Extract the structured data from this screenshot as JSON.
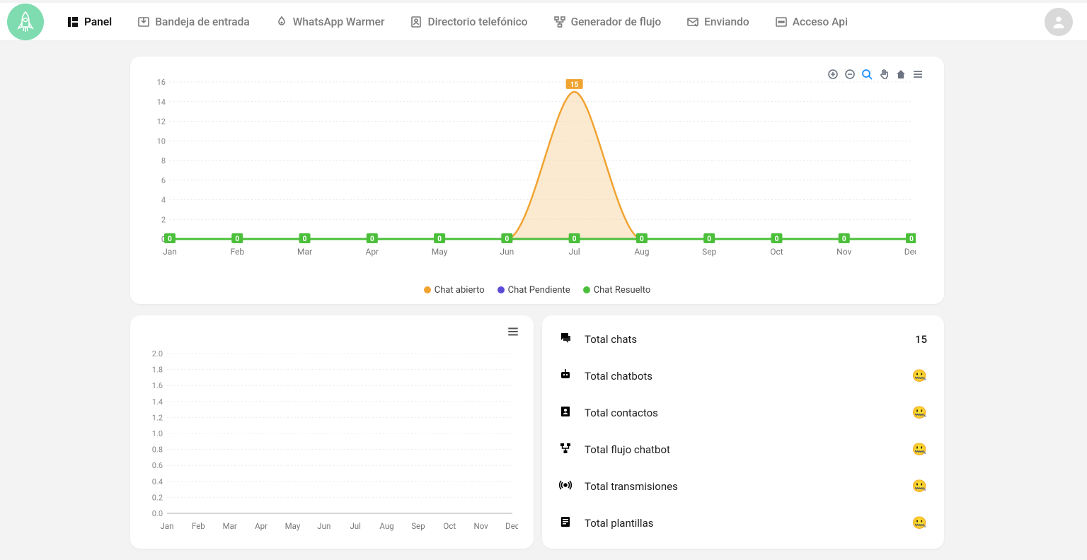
{
  "nav": [
    {
      "id": "panel",
      "label": "Panel",
      "active": true
    },
    {
      "id": "inbox",
      "label": "Bandeja de entrada",
      "active": false
    },
    {
      "id": "warmer",
      "label": "WhatsApp Warmer",
      "active": false
    },
    {
      "id": "phonebook",
      "label": "Directorio telefónico",
      "active": false
    },
    {
      "id": "flow",
      "label": "Generador de flujo",
      "active": false
    },
    {
      "id": "sending",
      "label": "Enviando",
      "active": false
    },
    {
      "id": "api",
      "label": "Acceso Api",
      "active": false
    }
  ],
  "stats": [
    {
      "icon": "chat",
      "label": "Total chats",
      "value": "15"
    },
    {
      "icon": "bot",
      "label": "Total chatbots",
      "value": "🤐"
    },
    {
      "icon": "contacts",
      "label": "Total contactos",
      "value": "🤐"
    },
    {
      "icon": "flow",
      "label": "Total flujo chatbot",
      "value": "🤐"
    },
    {
      "icon": "broadcast",
      "label": "Total transmisiones",
      "value": "🤐"
    },
    {
      "icon": "templates",
      "label": "Total plantillas",
      "value": "🤐"
    }
  ],
  "chart_data": [
    {
      "type": "area",
      "categories": [
        "Jan",
        "Feb",
        "Mar",
        "Apr",
        "May",
        "Jun",
        "Jul",
        "Aug",
        "Sep",
        "Oct",
        "Nov",
        "Dec"
      ],
      "series": [
        {
          "name": "Chat abierto",
          "color": "#f0a330",
          "values": [
            0,
            0,
            0,
            0,
            0,
            0,
            15,
            0,
            0,
            0,
            0,
            0
          ],
          "peak_label": "15",
          "peak_index": 6
        },
        {
          "name": "Chat Pendiente",
          "color": "#5b4bd6",
          "values": [
            0,
            0,
            0,
            0,
            0,
            0,
            0,
            0,
            0,
            0,
            0,
            0
          ]
        },
        {
          "name": "Chat Resuelto",
          "color": "#4bbf3a",
          "values": [
            0,
            0,
            0,
            0,
            0,
            0,
            0,
            0,
            0,
            0,
            0,
            0
          ],
          "labels_on_points": true
        }
      ],
      "ylim": [
        0,
        16
      ],
      "yticks": [
        0,
        2,
        4,
        6,
        8,
        10,
        12,
        14,
        16
      ]
    },
    {
      "type": "line",
      "categories": [
        "Jan",
        "Feb",
        "Mar",
        "Apr",
        "May",
        "Jun",
        "Jul",
        "Aug",
        "Sep",
        "Oct",
        "Nov",
        "Dec"
      ],
      "series": [
        {
          "name": "",
          "color": "#cccccc",
          "values": [
            0,
            0,
            0,
            0,
            0,
            0,
            0,
            0,
            0,
            0,
            0,
            0
          ]
        }
      ],
      "ylim": [
        0,
        2.0
      ],
      "yticks": [
        0,
        0.2,
        0.4,
        0.6,
        0.8,
        1.0,
        1.2,
        1.4,
        1.6,
        1.8,
        2.0
      ]
    }
  ]
}
